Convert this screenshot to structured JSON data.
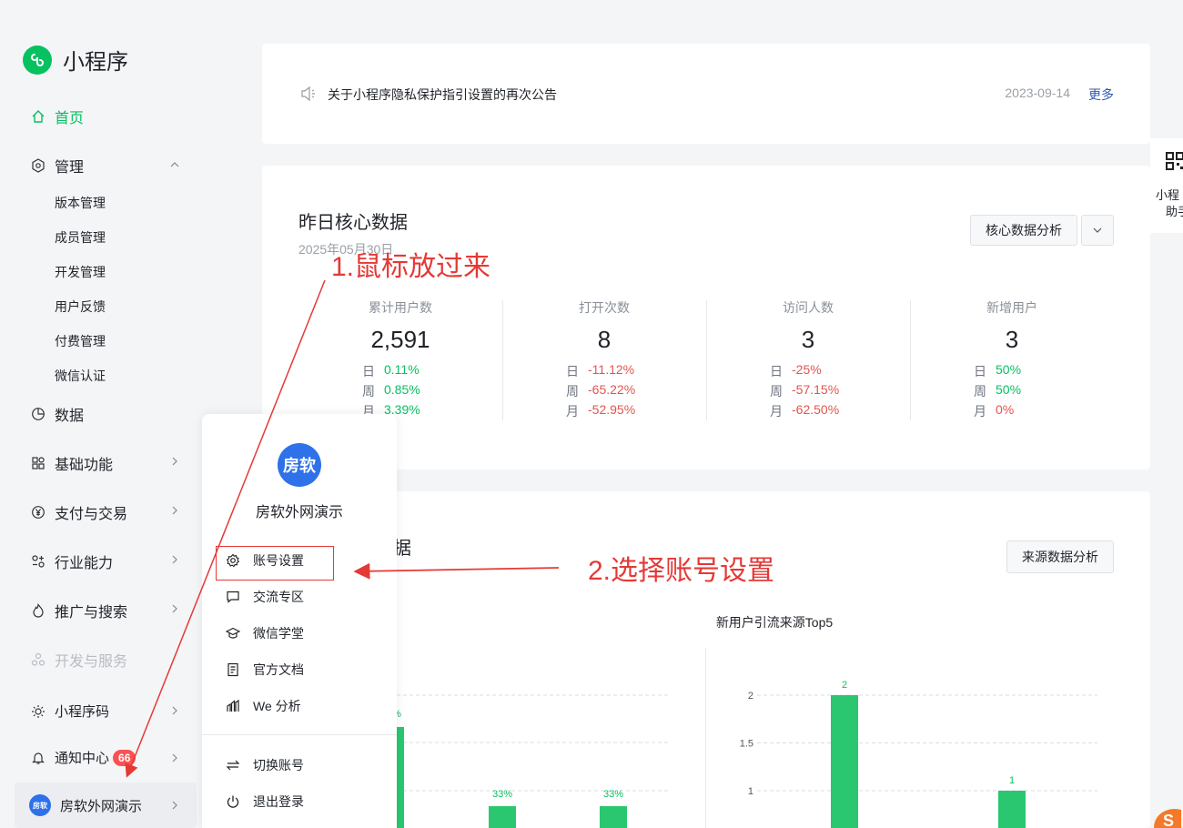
{
  "app": {
    "logo_text": "小程序"
  },
  "sidebar": {
    "home": "首页",
    "manage": "管理",
    "manage_sub": [
      "版本管理",
      "成员管理",
      "开发管理",
      "用户反馈",
      "付费管理",
      "微信认证"
    ],
    "data": "数据",
    "basic": "基础功能",
    "pay": "支付与交易",
    "industry": "行业能力",
    "promo": "推广与搜索",
    "devsvc": "开发与服务",
    "qrcode": "小程序码",
    "notice_center": "通知中心",
    "notice_badge": "66",
    "account": "房软外网演示",
    "account_avatar": "房软"
  },
  "notice": {
    "text": "关于小程序隐私保护指引设置的再次公告",
    "date": "2023-09-14",
    "more": "更多"
  },
  "core": {
    "title": "昨日核心数据",
    "date": "2025年05月30日",
    "analysis_btn": "核心数据分析",
    "stats": [
      {
        "label": "累计用户数",
        "value": "2,591",
        "rows": [
          {
            "k": "日",
            "v": "0.11%",
            "dir": "up"
          },
          {
            "k": "周",
            "v": "0.85%",
            "dir": "up"
          },
          {
            "k": "月",
            "v": "3.39%",
            "dir": "up"
          }
        ]
      },
      {
        "label": "打开次数",
        "value": "8",
        "rows": [
          {
            "k": "日",
            "v": "-11.12%",
            "dir": "down"
          },
          {
            "k": "周",
            "v": "-65.22%",
            "dir": "down"
          },
          {
            "k": "月",
            "v": "-52.95%",
            "dir": "down"
          }
        ]
      },
      {
        "label": "访问人数",
        "value": "3",
        "rows": [
          {
            "k": "日",
            "v": "-25%",
            "dir": "down"
          },
          {
            "k": "周",
            "v": "-57.15%",
            "dir": "down"
          },
          {
            "k": "月",
            "v": "-62.50%",
            "dir": "down"
          }
        ]
      },
      {
        "label": "新增用户",
        "value": "3",
        "rows": [
          {
            "k": "日",
            "v": "50%",
            "dir": "up"
          },
          {
            "k": "周",
            "v": "50%",
            "dir": "up"
          },
          {
            "k": "月",
            "v": "0%",
            "dir": "down"
          }
        ]
      }
    ]
  },
  "source": {
    "title_partial": "据",
    "analysis_btn": "来源数据分析"
  },
  "chart_data": [
    {
      "type": "bar",
      "title": "",
      "values_labels": [
        "%",
        "33%",
        "33%"
      ],
      "note": "partially hidden by popup"
    },
    {
      "type": "bar",
      "title": "新用户引流来源Top5",
      "yticks": [
        "2",
        "1.5",
        "1"
      ],
      "values": [
        2,
        1
      ],
      "data_labels": [
        "2",
        "1"
      ],
      "ylim": [
        0,
        2
      ]
    }
  ],
  "popup": {
    "avatar": "房软",
    "name": "房软外网演示",
    "menu": [
      "账号设置",
      "交流专区",
      "微信学堂",
      "官方文档",
      "We 分析"
    ],
    "menu2": [
      "切换账号",
      "退出登录"
    ]
  },
  "annotations": {
    "step1": "1.鼠标放过来",
    "step2": "2.选择账号设置"
  },
  "side_tab": {
    "line1": "小程",
    "line2": "助手"
  },
  "colors": {
    "accent": "#07c160",
    "down": "#e0554f",
    "annotation": "#e53935"
  }
}
